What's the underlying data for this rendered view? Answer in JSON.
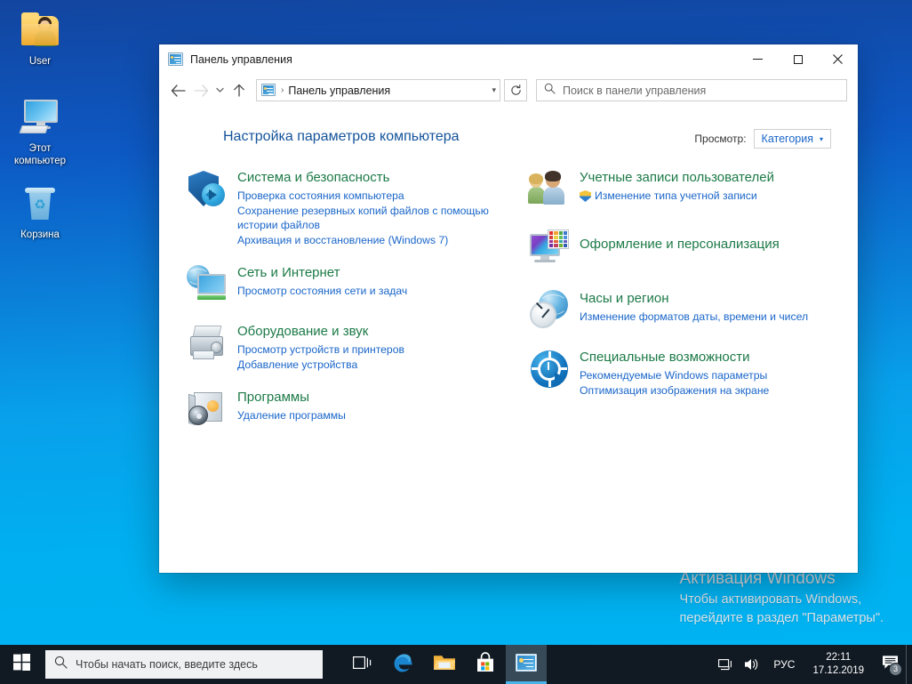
{
  "desktop": {
    "icons": [
      {
        "name": "user-folder",
        "label": "User"
      },
      {
        "name": "this-pc",
        "label": "Этот\nкомпьютер",
        "line1": "Этот",
        "line2": "компьютер"
      },
      {
        "name": "recycle-bin",
        "label": "Корзина"
      }
    ],
    "watermark": {
      "title": "Активация Windows",
      "line1": "Чтобы активировать Windows,",
      "line2": "перейдите в раздел \"Параметры\"."
    },
    "background_top": "#12459f",
    "background_bottom": "#00b4f2"
  },
  "window": {
    "title": "Панель управления",
    "icon": "control-panel-icon",
    "buttons": {
      "minimize": "—",
      "maximize": "□",
      "close": "✕"
    },
    "nav": {
      "back": "back-arrow-icon",
      "forward": "forward-arrow-icon",
      "recent": "chevron-down-icon",
      "up": "up-arrow-icon",
      "refresh": "refresh-icon"
    },
    "address": {
      "crumb": "Панель управления",
      "separator": "›",
      "chevron": "▾"
    },
    "search": {
      "placeholder": "Поиск в панели управления",
      "icon": "search-icon"
    }
  },
  "content": {
    "page_title": "Настройка параметров компьютера",
    "view_by": {
      "label": "Просмотр:",
      "value": "Категория",
      "arrow": "▾"
    },
    "left_column": [
      {
        "icon": "system-security-icon",
        "title": "Система и безопасность",
        "links": [
          "Проверка состояния компьютера",
          "Сохранение резервных копий файлов с помощью истории файлов",
          "Архивация и восстановление (Windows 7)"
        ]
      },
      {
        "icon": "network-internet-icon",
        "title": "Сеть и Интернет",
        "links": [
          "Просмотр состояния сети и задач"
        ]
      },
      {
        "icon": "hardware-sound-icon",
        "title": "Оборудование и звук",
        "links": [
          "Просмотр устройств и принтеров",
          "Добавление устройства"
        ]
      },
      {
        "icon": "programs-icon",
        "title": "Программы",
        "links": [
          "Удаление программы"
        ]
      }
    ],
    "right_column": [
      {
        "icon": "user-accounts-icon",
        "title": "Учетные записи пользователей",
        "links": [
          "Изменение типа учетной записи"
        ],
        "shield_on_first_link": true
      },
      {
        "icon": "appearance-personalization-icon",
        "title": "Оформление и персонализация",
        "links": []
      },
      {
        "icon": "clock-region-icon",
        "title": "Часы и регион",
        "links": [
          "Изменение форматов даты, времени и чисел"
        ]
      },
      {
        "icon": "ease-of-access-icon",
        "title": "Специальные возможности",
        "links": [
          "Рекомендуемые Windows параметры",
          "Оптимизация изображения на экране"
        ]
      }
    ],
    "heading_color": "#1c7a47",
    "link_color": "#1a66c9",
    "title_color": "#14539a"
  },
  "taskbar": {
    "start": "windows-logo-icon",
    "search": {
      "placeholder": "Чтобы начать поиск, введите здесь",
      "icon": "search-icon"
    },
    "buttons": [
      {
        "name": "task-view-icon",
        "label": "Task View"
      },
      {
        "name": "edge-icon",
        "label": "Microsoft Edge"
      },
      {
        "name": "file-explorer-icon",
        "label": "Проводник"
      },
      {
        "name": "microsoft-store-icon",
        "label": "Microsoft Store"
      },
      {
        "name": "control-panel-taskbar-icon",
        "label": "Панель управления",
        "active": true
      }
    ],
    "tray": {
      "network": "network-icon",
      "volume": "volume-icon",
      "language": "РУС",
      "time": "22:11",
      "date": "17.12.2019",
      "notifications": "notifications-icon",
      "notification_count": "3"
    }
  }
}
